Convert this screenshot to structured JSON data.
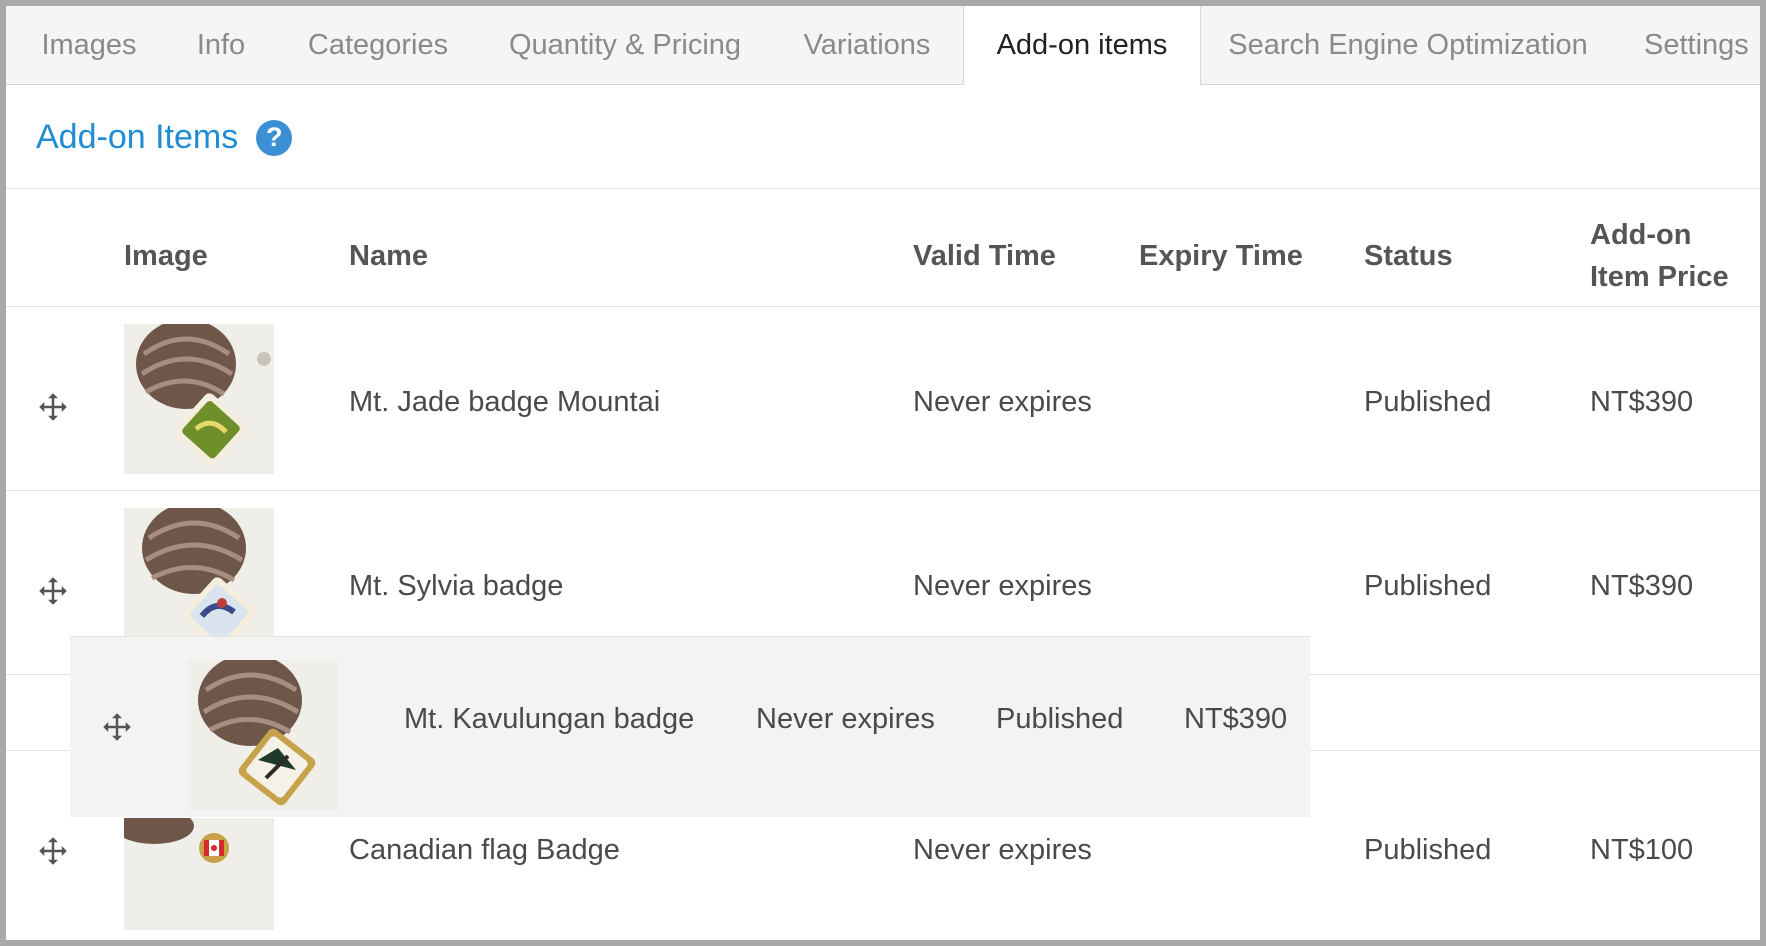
{
  "tabs": [
    {
      "label": "Images"
    },
    {
      "label": "Info"
    },
    {
      "label": "Categories"
    },
    {
      "label": "Quantity & Pricing"
    },
    {
      "label": "Variations"
    },
    {
      "label": "Add-on items"
    },
    {
      "label": "Search Engine Optimization"
    },
    {
      "label": "Settings"
    }
  ],
  "active_tab": "Add-on items",
  "section": {
    "title": "Add-on Items",
    "help_glyph": "?"
  },
  "columns": {
    "image": "Image",
    "name": "Name",
    "valid_time": "Valid Time",
    "expiry_time": "Expiry Time",
    "status": "Status",
    "price_line1": "Add-on",
    "price_line2": "Item Price"
  },
  "rows": [
    {
      "name": "Mt. Jade badge Mountai",
      "valid_time": "Never expires",
      "expiry_time": "",
      "status": "Published",
      "price": "NT$390"
    },
    {
      "name": "Mt. Sylvia badge",
      "valid_time": "Never expires",
      "expiry_time": "",
      "status": "Published",
      "price": "NT$390"
    },
    {
      "name": "Canadian flag Badge",
      "valid_time": "Never expires",
      "expiry_time": "",
      "status": "Published",
      "price": "NT$100"
    }
  ],
  "dragging_row": {
    "name": "Mt. Kavulungan badge",
    "valid_time": "Never expires",
    "status": "Published",
    "price": "NT$390"
  },
  "icons": {
    "drag_handle": "move-arrows-icon",
    "help": "question-circle-icon"
  },
  "colors": {
    "accent": "#1f8dd6",
    "help_icon": "#3b8fd4",
    "tab_bar": "#f5f5f5"
  }
}
